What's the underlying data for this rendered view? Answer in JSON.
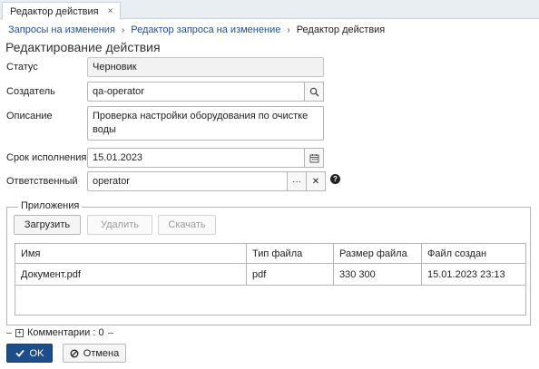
{
  "tab": {
    "title": "Редактор действия",
    "close": "×"
  },
  "breadcrumb": {
    "items": [
      "Запросы на изменения",
      "Редактор запроса на изменение"
    ],
    "current": "Редактор действия",
    "separator": "›"
  },
  "page_title": "Редактирование действия",
  "form": {
    "status": {
      "label": "Статус",
      "value": "Черновик"
    },
    "creator": {
      "label": "Создатель",
      "value": "qa-operator"
    },
    "description": {
      "label": "Описание",
      "value": "Проверка настройки оборудования по очистке воды"
    },
    "due_date": {
      "label": "Срок исполнения",
      "value": "15.01.2023"
    },
    "responsible": {
      "label": "Ответственный",
      "value": "operator",
      "more": "···",
      "clear": "✕",
      "help": "?"
    }
  },
  "attachments": {
    "legend": "Приложения",
    "buttons": {
      "upload": "Загрузить",
      "delete": "Удалить",
      "download": "Скачать"
    },
    "columns": [
      "Имя",
      "Тип файла",
      "Размер файла",
      "Файл создан"
    ],
    "rows": [
      [
        "Документ.pdf",
        "pdf",
        "330 300",
        "15.01.2023 23:13"
      ]
    ]
  },
  "comments": {
    "label": "Комментарии : 0"
  },
  "footer": {
    "ok": "OK",
    "cancel": "Отмена"
  },
  "colors": {
    "primary": "#1e4d8b",
    "link": "#1e4f8c"
  }
}
